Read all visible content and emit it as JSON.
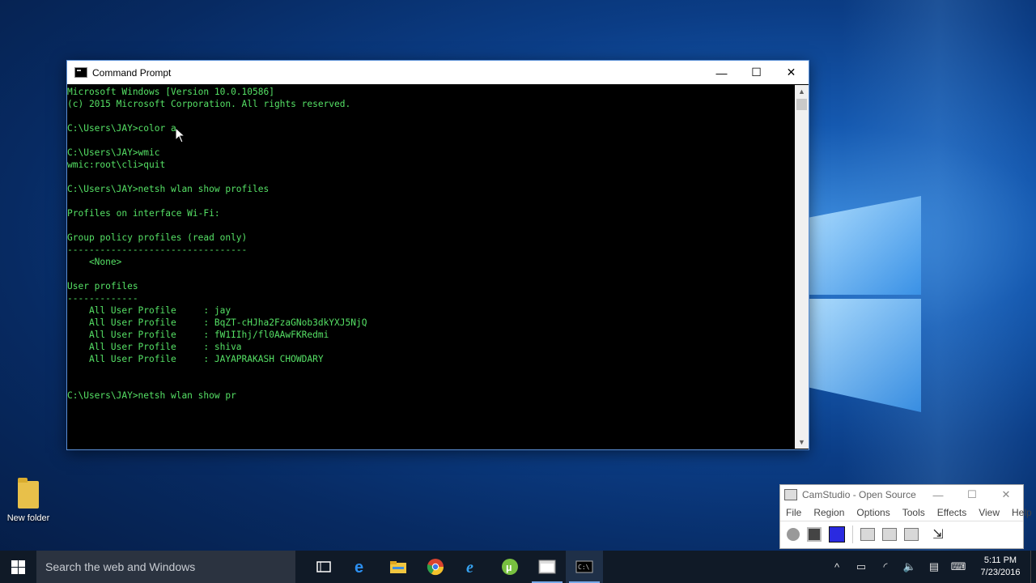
{
  "desktop": {
    "icons": [
      {
        "label": "New folder"
      }
    ]
  },
  "cmd_window": {
    "title": "Command Prompt",
    "controls": {
      "minimize": "—",
      "maximize": "☐",
      "close": "✕"
    },
    "text_color": "#55e065",
    "lines": [
      "Microsoft Windows [Version 10.0.10586]",
      "(c) 2015 Microsoft Corporation. All rights reserved.",
      "",
      "C:\\Users\\JAY>color a",
      "",
      "C:\\Users\\JAY>wmic",
      "wmic:root\\cli>quit",
      "",
      "C:\\Users\\JAY>netsh wlan show profiles",
      "",
      "Profiles on interface Wi-Fi:",
      "",
      "Group policy profiles (read only)",
      "---------------------------------",
      "    <None>",
      "",
      "User profiles",
      "-------------",
      "    All User Profile     : jay",
      "    All User Profile     : BqZT-cHJha2FzaGNob3dkYXJ5NjQ",
      "    All User Profile     : fW1IIhj/fl0AAwFKRedmi",
      "    All User Profile     : shiva",
      "    All User Profile     : JAYAPRAKASH CHOWDARY",
      "",
      "",
      "C:\\Users\\JAY>netsh wlan show pr"
    ]
  },
  "camstudio": {
    "title": "CamStudio - Open Source",
    "menu": [
      "File",
      "Region",
      "Options",
      "Tools",
      "Effects",
      "View",
      "Help"
    ]
  },
  "taskbar": {
    "search_placeholder": "Search the web and Windows",
    "clock_time": "5:11 PM",
    "clock_date": "7/23/2016"
  },
  "colors": {
    "taskbar": "#101a27",
    "console_bg": "#000000",
    "console_text": "#55e065"
  }
}
